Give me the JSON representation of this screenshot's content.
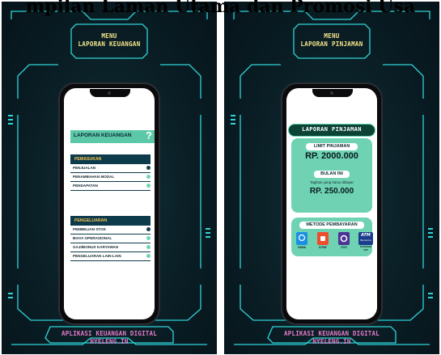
{
  "page_title": "mpilan Laman Utama dan Promosi Usa",
  "left_panel": {
    "menu_line1": "MENU",
    "menu_line2": "LAPORAN KEUANGAN",
    "header_title": "LAPORAN KEUANGAN",
    "header_icon": "?",
    "pemasukan": {
      "title": "PEMASUKAN",
      "items": [
        "PENJUALAN",
        "PENAMBAHAN MODAL",
        "PENDAPATAN"
      ]
    },
    "pengeluaran": {
      "title": "PENGELUARAN",
      "items": [
        "PEMBELIAN STOK",
        "BIAYA OPERASIONAL",
        "GAJI/BONUS KARYAWAN",
        "PENGELUARAN LAIN-LAIN"
      ]
    },
    "footer_line1": "APLIKASI KEUANGAN DIGITAL",
    "footer_line2": "NYELENG.IN"
  },
  "right_panel": {
    "menu_line1": "MENU",
    "menu_line2": "LAPORAN PINJAMAN",
    "header_title": "LAPORAN PINJAMAN",
    "limit_label": "LIMIT PINJAMAN",
    "limit_value": "RP. 2000.000",
    "month_label": "BULAN INI",
    "month_sub": "Tagihan yang harus dibayar",
    "month_value": "RP. 250.000",
    "payment_title": "METODE PEMBAYARAN",
    "payments": [
      "DANA",
      "S-PAY",
      "OVO",
      "TRANSFER ATM"
    ],
    "atm_logo_line1": "ATM",
    "atm_logo_line2": "Bersama",
    "footer_line1": "APLIKASI KEUANGAN DIGITAL",
    "footer_line2": "NYELENG.IN"
  },
  "colors": {
    "panel_bg": "#0a1e25",
    "frame_cyan": "#2fd4d8",
    "menu_text": "#f4e58a",
    "footer_text": "#e87ac9",
    "accent_green": "#6fd3b3",
    "dark_teal": "#0e3b4b",
    "section_title": "#f4c24d"
  }
}
